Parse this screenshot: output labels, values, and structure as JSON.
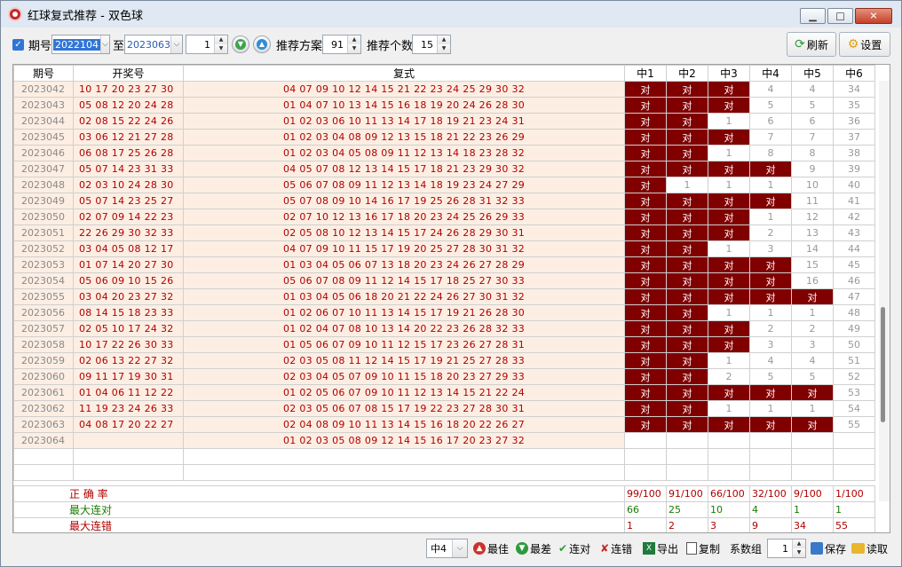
{
  "window": {
    "title": "红球复式推荐 - 双色球"
  },
  "toolbar": {
    "period_label": "期号",
    "period_from": "2022104",
    "to_label": "至",
    "period_to": "2023063",
    "step_value": "1",
    "scheme_label": "推荐方案",
    "scheme_value": "91",
    "count_label": "推荐个数",
    "count_value": "15",
    "refresh_label": "刷新",
    "settings_label": "设置"
  },
  "table": {
    "headers": [
      "期号",
      "开奖号",
      "复式",
      "中1",
      "中2",
      "中3",
      "中4",
      "中5",
      "中6"
    ],
    "rows": [
      {
        "qh": "2023042",
        "kj": "10 17 20 23 27 30",
        "fs": "04 07 09 10 12 14 15 21 22 23 24 25 29 30 32",
        "z": [
          "对",
          "对",
          "对",
          "4",
          "4",
          "34"
        ]
      },
      {
        "qh": "2023043",
        "kj": "05 08 12 20 24 28",
        "fs": "01 04 07 10 13 14 15 16 18 19 20 24 26 28 30",
        "z": [
          "对",
          "对",
          "对",
          "5",
          "5",
          "35"
        ]
      },
      {
        "qh": "2023044",
        "kj": "02 08 15 22 24 26",
        "fs": "01 02 03 06 10 11 13 14 17 18 19 21 23 24 31",
        "z": [
          "对",
          "对",
          "1",
          "6",
          "6",
          "36"
        ]
      },
      {
        "qh": "2023045",
        "kj": "03 06 12 21 27 28",
        "fs": "01 02 03 04 08 09 12 13 15 18 21 22 23 26 29",
        "z": [
          "对",
          "对",
          "对",
          "7",
          "7",
          "37"
        ]
      },
      {
        "qh": "2023046",
        "kj": "06 08 17 25 26 28",
        "fs": "01 02 03 04 05 08 09 11 12 13 14 18 23 28 32",
        "z": [
          "对",
          "对",
          "1",
          "8",
          "8",
          "38"
        ]
      },
      {
        "qh": "2023047",
        "kj": "05 07 14 23 31 33",
        "fs": "04 05 07 08 12 13 14 15 17 18 21 23 29 30 32",
        "z": [
          "对",
          "对",
          "对",
          "对",
          "9",
          "39"
        ]
      },
      {
        "qh": "2023048",
        "kj": "02 03 10 24 28 30",
        "fs": "05 06 07 08 09 11 12 13 14 18 19 23 24 27 29",
        "z": [
          "对",
          "1",
          "1",
          "1",
          "10",
          "40"
        ]
      },
      {
        "qh": "2023049",
        "kj": "05 07 14 23 25 27",
        "fs": "05 07 08 09 10 14 16 17 19 25 26 28 31 32 33",
        "z": [
          "对",
          "对",
          "对",
          "对",
          "11",
          "41"
        ]
      },
      {
        "qh": "2023050",
        "kj": "02 07 09 14 22 23",
        "fs": "02 07 10 12 13 16 17 18 20 23 24 25 26 29 33",
        "z": [
          "对",
          "对",
          "对",
          "1",
          "12",
          "42"
        ]
      },
      {
        "qh": "2023051",
        "kj": "22 26 29 30 32 33",
        "fs": "02 05 08 10 12 13 14 15 17 24 26 28 29 30 31",
        "z": [
          "对",
          "对",
          "对",
          "2",
          "13",
          "43"
        ]
      },
      {
        "qh": "2023052",
        "kj": "03 04 05 08 12 17",
        "fs": "04 07 09 10 11 15 17 19 20 25 27 28 30 31 32",
        "z": [
          "对",
          "对",
          "1",
          "3",
          "14",
          "44"
        ]
      },
      {
        "qh": "2023053",
        "kj": "01 07 14 20 27 30",
        "fs": "01 03 04 05 06 07 13 18 20 23 24 26 27 28 29",
        "z": [
          "对",
          "对",
          "对",
          "对",
          "15",
          "45"
        ]
      },
      {
        "qh": "2023054",
        "kj": "05 06 09 10 15 26",
        "fs": "05 06 07 08 09 11 12 14 15 17 18 25 27 30 33",
        "z": [
          "对",
          "对",
          "对",
          "对",
          "16",
          "46"
        ]
      },
      {
        "qh": "2023055",
        "kj": "03 04 20 23 27 32",
        "fs": "01 03 04 05 06 18 20 21 22 24 26 27 30 31 32",
        "z": [
          "对",
          "对",
          "对",
          "对",
          "对",
          "47"
        ]
      },
      {
        "qh": "2023056",
        "kj": "08 14 15 18 23 33",
        "fs": "01 02 06 07 10 11 13 14 15 17 19 21 26 28 30",
        "z": [
          "对",
          "对",
          "1",
          "1",
          "1",
          "48"
        ]
      },
      {
        "qh": "2023057",
        "kj": "02 05 10 17 24 32",
        "fs": "01 02 04 07 08 10 13 14 20 22 23 26 28 32 33",
        "z": [
          "对",
          "对",
          "对",
          "2",
          "2",
          "49"
        ]
      },
      {
        "qh": "2023058",
        "kj": "10 17 22 26 30 33",
        "fs": "01 05 06 07 09 10 11 12 15 17 23 26 27 28 31",
        "z": [
          "对",
          "对",
          "对",
          "3",
          "3",
          "50"
        ]
      },
      {
        "qh": "2023059",
        "kj": "02 06 13 22 27 32",
        "fs": "02 03 05 08 11 12 14 15 17 19 21 25 27 28 33",
        "z": [
          "对",
          "对",
          "1",
          "4",
          "4",
          "51"
        ]
      },
      {
        "qh": "2023060",
        "kj": "09 11 17 19 30 31",
        "fs": "02 03 04 05 07 09 10 11 15 18 20 23 27 29 33",
        "z": [
          "对",
          "对",
          "2",
          "5",
          "5",
          "52"
        ]
      },
      {
        "qh": "2023061",
        "kj": "01 04 06 11 12 22",
        "fs": "01 02 05 06 07 09 10 11 12 13 14 15 21 22 24",
        "z": [
          "对",
          "对",
          "对",
          "对",
          "对",
          "53"
        ]
      },
      {
        "qh": "2023062",
        "kj": "11 19 23 24 26 33",
        "fs": "02 03 05 06 07 08 15 17 19 22 23 27 28 30 31",
        "z": [
          "对",
          "对",
          "1",
          "1",
          "1",
          "54"
        ]
      },
      {
        "qh": "2023063",
        "kj": "04 08 17 20 22 27",
        "fs": "02 04 08 09 10 11 13 14 15 16 18 20 22 26 27",
        "z": [
          "对",
          "对",
          "对",
          "对",
          "对",
          "55"
        ]
      },
      {
        "qh": "2023064",
        "kj": "",
        "fs": "01 02 03 05 08 09 12 14 15 16 17 20 23 27 32",
        "z": [
          "",
          "",
          "",
          "",
          "",
          ""
        ]
      }
    ],
    "summary": [
      {
        "label": "正  确  率",
        "color": "#b00000",
        "values": [
          "99/100",
          "91/100",
          "66/100",
          "32/100",
          "9/100",
          "1/100"
        ]
      },
      {
        "label": "最大连对",
        "color": "#1a7a00",
        "values": [
          "66",
          "25",
          "10",
          "4",
          "1",
          "1"
        ]
      },
      {
        "label": "最大连错",
        "color": "#b00000",
        "values": [
          "1",
          "2",
          "3",
          "9",
          "34",
          "55"
        ]
      }
    ]
  },
  "bottombar": {
    "select_value": "中4",
    "best_label": "最佳",
    "worst_label": "最差",
    "conseq_hit_label": "连对",
    "conseq_miss_label": "连错",
    "export_label": "导出",
    "copy_label": "复制",
    "coef_label": "系数组",
    "coef_value": "1",
    "save_label": "保存",
    "load_label": "读取"
  },
  "colors": {
    "hit_bg": "#800000",
    "row_bg": "#fdeee3",
    "red_text": "#b00000"
  }
}
